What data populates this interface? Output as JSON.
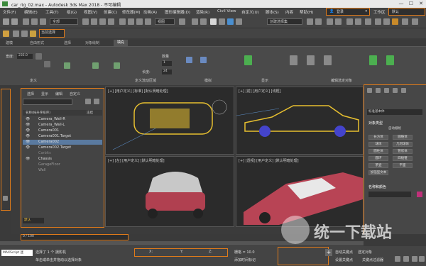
{
  "title_bar": {
    "title": "car_rig_02.max - Autodesk 3ds Max 2018 - 不可编辑",
    "minimize": "—",
    "maximize": "☐",
    "close": "✕"
  },
  "menu": [
    "文件(F)",
    "编辑(E)",
    "工具(T)",
    "组(G)",
    "视图(V)",
    "创建(C)",
    "修改器(M)",
    "动画(A)",
    "图形编辑器(D)",
    "渲染(R)",
    "Civil View",
    "自定义(U)",
    "脚本(S)",
    "内容",
    "帮助(H)"
  ],
  "user": {
    "label": "登录"
  },
  "workspace": {
    "label": "工作区",
    "value": "默认"
  },
  "toolbar": {
    "filter": "全部",
    "named_set": "创建选择集",
    "view": "视图",
    "selection_set": "当前选择"
  },
  "ribbon": {
    "tabs": [
      "建模",
      "自由形式",
      "选择",
      "对象绘制",
      "填充"
    ],
    "groups": [
      "定义",
      "定义流动区域",
      "模拟",
      "显示",
      "编辑选定对象"
    ],
    "fields": {
      "width_label": "宽度:",
      "width_value": "235.0",
      "length_label": "长度:",
      "length_value": "24",
      "count_label": "数量",
      "count_value": "1"
    }
  },
  "explorer": {
    "tabs": [
      "选择",
      "显示",
      "编辑",
      "自定义"
    ],
    "header": "名称(按升序排序)",
    "header_right": "冻结",
    "items": [
      "Camera_Wall-R",
      "Camera_Wall-L",
      "Camera001",
      "Camera001.Target",
      "Camera002",
      "Camera002.Target",
      "Carbits",
      "Chassis",
      "GarageFloor",
      "Wall"
    ],
    "layer_label": "默认"
  },
  "viewports": {
    "top_left": "[+] [用户定义] [标准] [默认明暗处理]",
    "top_right": "[+] [前] [用户定义] [线框]",
    "bottom_left": "[+] [左] [用户定义] [默认明暗处理]",
    "bottom_right": "[+] [透视] [用户定义] [默认明暗处理]"
  },
  "command_panel": {
    "section": "标准基本体",
    "rollout": "对象类型",
    "autogrid": "自动栅格",
    "buttons": [
      "长方体",
      "圆锥体",
      "球体",
      "几何球体",
      "圆柱体",
      "管状体",
      "圆环",
      "四棱锥",
      "茶壶",
      "平面"
    ],
    "extra": "加强型文本",
    "name_color": "名称和颜色"
  },
  "timeline": {
    "frame": "0 / 100"
  },
  "status_bar": {
    "selected": "选择了 1 个 摄影机",
    "hint": "单击或单击并拖动以选择对象",
    "maxscript": "MAXScript 迷",
    "x": "X:",
    "y": "Y:",
    "z": "Z:",
    "grid": "栅格 = 10.0",
    "add_time_tag": "添加时间标记",
    "auto_key": "自动关键点",
    "set_key": "设置关键点",
    "selected_obj": "选定对象",
    "key_filters": "关键点过滤器"
  },
  "watermark": "统一下载站"
}
